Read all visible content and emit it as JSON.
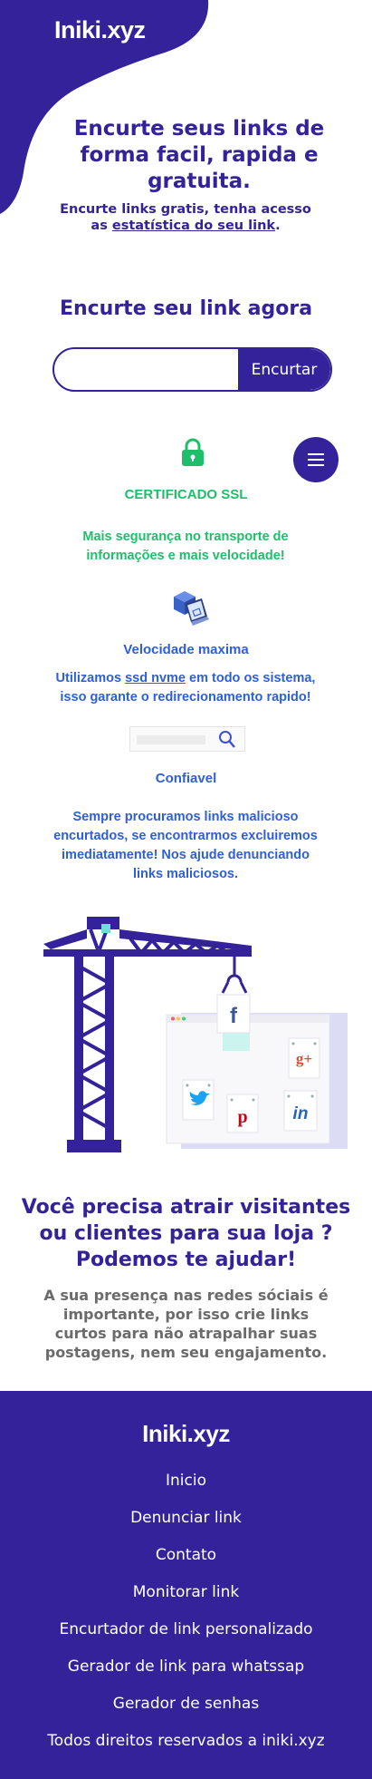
{
  "brand": {
    "logo": "Iniki.xyz",
    "primary_color": "#33229a",
    "green": "#1fbe6b",
    "blue": "#2e5fd6"
  },
  "hero": {
    "title": "Encurte seus links de forma facil, rapida e gratuita.",
    "subtitle_pre": "Encurte links gratis, tenha acesso as ",
    "subtitle_link": "estatística do seu link",
    "subtitle_post": "."
  },
  "shortener": {
    "title": "Encurte seu link agora",
    "input_value": "",
    "button_label": "Encurtar"
  },
  "menu": {
    "icon": "hamburger-icon"
  },
  "features": [
    {
      "icon": "lock-icon",
      "title": "CERTIFICADO SSL",
      "text": "Mais segurança no transporte de informações e mais velocidade!"
    },
    {
      "icon": "laptop-speed-icon",
      "title": "Velocidade maxima",
      "text_pre": "Utilizamos ",
      "text_link": "ssd nvme",
      "text_post": " em todo os sistema, isso garante o redirecionamento rapido!"
    },
    {
      "icon": "search-icon",
      "title": "Confiavel",
      "text": "Sempre procuramos links malicioso encurtados, se encontrarmos excluiremos imediatamente! Nos ajude denunciando links maliciosos."
    }
  ],
  "illustration": {
    "icons": [
      "crane-icon",
      "facebook-icon",
      "google-plus-icon",
      "twitter-icon",
      "pinterest-icon",
      "linkedin-icon"
    ]
  },
  "cta": {
    "title": "Você precisa atrair visitantes ou clientes para sua loja ? Podemos te ajudar!",
    "text": "A sua presença nas redes sóciais é importante, por isso crie links curtos para não atrapalhar suas postagens, nem seu engajamento."
  },
  "footer": {
    "logo": "Iniki.xyz",
    "links": [
      "Inicio",
      "Denunciar link",
      "Contato",
      "Monitorar link",
      "Encurtador de link personalizado",
      "Gerador de link para whatssap",
      "Gerador de senhas"
    ],
    "copyright": "Todos direitos reservados a iniki.xyz"
  }
}
